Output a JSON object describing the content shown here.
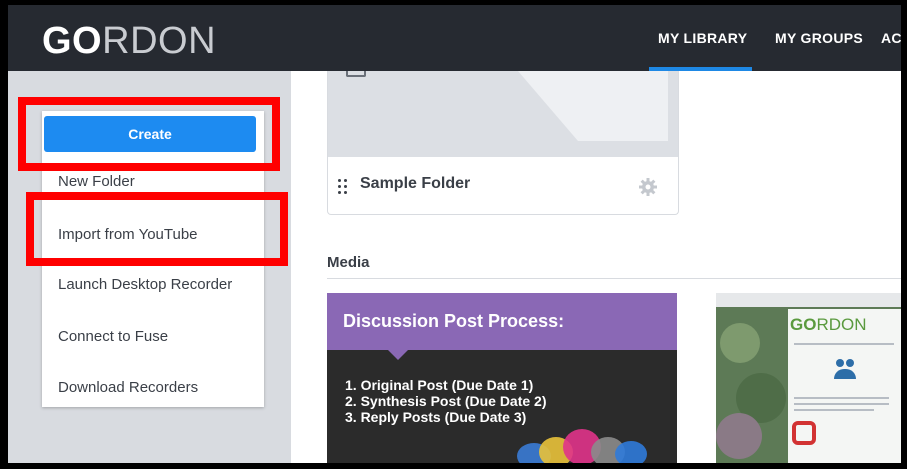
{
  "header": {
    "logo_bold": "GO",
    "logo_thin": "RDON",
    "nav": [
      "MY LIBRARY",
      "MY GROUPS",
      "AC"
    ]
  },
  "sidebar": {
    "create_label": "Create",
    "menu": [
      "New Folder",
      "Import from YouTube",
      "Launch Desktop Recorder",
      "Connect to Fuse",
      "Download Recorders"
    ]
  },
  "folder": {
    "title": "Sample Folder"
  },
  "media": {
    "heading": "Media",
    "card1": {
      "title": "Discussion Post Process:",
      "items": [
        "1.  Original Post (Due Date 1)",
        "2.  Synthesis Post (Due Date 2)",
        "3.  Reply Posts (Due Date 3)"
      ]
    },
    "card2": {
      "logo_bold": "GO",
      "logo_thin": "RDON"
    }
  },
  "colors": {
    "header_bg": "#262a31",
    "accent": "#1d8bf1",
    "highlight": "#ff0000",
    "sidebar_bg": "#d8dbe0",
    "card_purple": "#8a68b5"
  }
}
